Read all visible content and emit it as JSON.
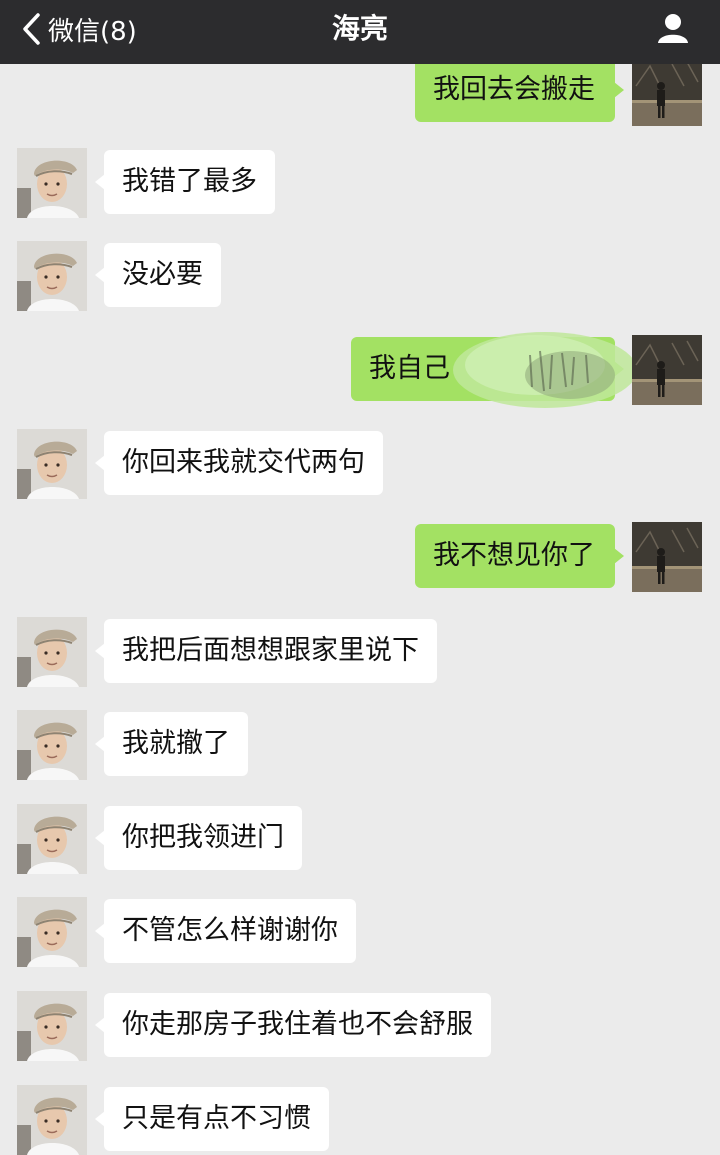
{
  "header": {
    "back_label": "微信(8)",
    "title": "海亮"
  },
  "colors": {
    "header_bg": "#2c2c2e",
    "chat_bg": "#ebebeb",
    "outgoing_bubble": "#a3e163",
    "incoming_bubble": "#ffffff"
  },
  "messages": [
    {
      "sender": "me",
      "text": "我回去会搬走"
    },
    {
      "sender": "contact",
      "text": "我错了最多"
    },
    {
      "sender": "contact",
      "text": "没必要"
    },
    {
      "sender": "me",
      "text": "我自己"
    },
    {
      "sender": "contact",
      "text": "你回来我就交代两句"
    },
    {
      "sender": "me",
      "text": "我不想见你了"
    },
    {
      "sender": "contact",
      "text": "我把后面想想跟家里说下"
    },
    {
      "sender": "contact",
      "text": "我就撤了"
    },
    {
      "sender": "contact",
      "text": "你把我领进门"
    },
    {
      "sender": "contact",
      "text": "不管怎么样谢谢你"
    },
    {
      "sender": "contact",
      "text": "你走那房子我住着也不会舒服"
    },
    {
      "sender": "contact",
      "text": "只是有点不习惯"
    }
  ]
}
